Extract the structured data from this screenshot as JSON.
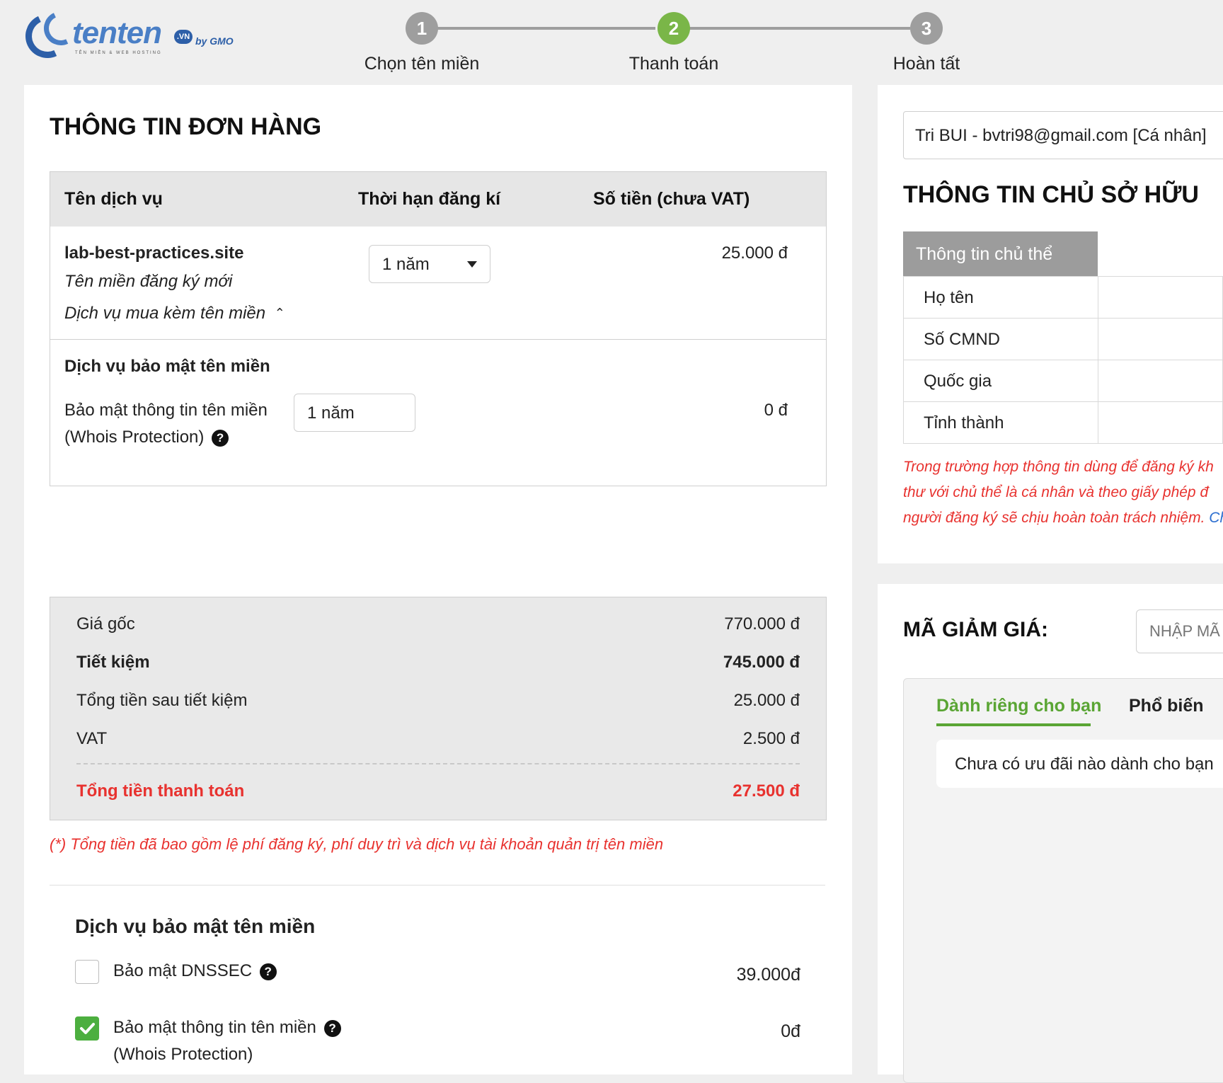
{
  "header": {
    "logo": {
      "brand": "tenten",
      "tld_badge": ".VN",
      "partner": "by GMO",
      "tagline": "TÊN MIỀN & WEB HOSTING"
    },
    "steps": [
      {
        "number": "1",
        "label": "Chọn tên miền",
        "state": "done"
      },
      {
        "number": "2",
        "label": "Thanh toán",
        "state": "active"
      },
      {
        "number": "3",
        "label": "Hoàn tất",
        "state": "pending"
      }
    ]
  },
  "order": {
    "title": "THÔNG TIN ĐƠN HÀNG",
    "columns": [
      "Tên dịch vụ",
      "Thời hạn đăng kí",
      "Số tiền (chưa VAT)"
    ],
    "domain_item": {
      "name": "lab-best-practices.site",
      "type": "Tên miền đăng ký mới",
      "addon_toggle": "Dịch vụ mua kèm tên miền",
      "term": "1 năm",
      "price": "25.000 đ"
    },
    "security_item": {
      "heading": "Dịch vụ bảo mật tên miền",
      "name_line1": "Bảo mật thông tin tên miền",
      "name_line2": "(Whois Protection)",
      "term": "1 năm",
      "price": "0 đ"
    },
    "summary": {
      "rows": [
        {
          "label": "Giá gốc",
          "value": "770.000 đ"
        },
        {
          "label": "Tiết kiệm",
          "value": "745.000 đ"
        },
        {
          "label": "Tổng tiền sau tiết kiệm",
          "value": "25.000 đ"
        },
        {
          "label": "VAT",
          "value": "2.500 đ"
        }
      ],
      "total_label": "Tổng tiền thanh toán",
      "total_value": "27.500 đ"
    },
    "note": "(*) Tổng tiền đã bao gồm lệ phí đăng ký, phí duy trì và dịch vụ tài khoản quản trị tên miền"
  },
  "security_services": {
    "heading": "Dịch vụ bảo mật tên miền",
    "options": [
      {
        "label": "Bảo mật DNSSEC",
        "label2": "",
        "price": "39.000đ",
        "checked": false
      },
      {
        "label": "Bảo mật thông tin tên miền",
        "label2": "(Whois Protection)",
        "price": "0đ",
        "checked": true
      }
    ]
  },
  "account": {
    "selected": "Tri BUI - bvtri98@gmail.com [Cá nhân]"
  },
  "owner": {
    "title": "THÔNG TIN CHỦ SỞ HỮU",
    "tab_label": "Thông tin chủ thể",
    "fields": [
      "Họ tên",
      "Số CMND",
      "Quốc gia",
      "Tỉnh thành"
    ],
    "warning_line1": "Trong trường hợp thông tin dùng để đăng ký kh",
    "warning_line2": "thư với chủ thể là cá nhân và theo giấy phép đ",
    "warning_line3": "người đăng ký sẽ chịu hoàn toàn trách nhiệm.",
    "warning_link": "Ch"
  },
  "discount": {
    "title": "MÃ GIẢM GIÁ:",
    "placeholder": "NHẬP MÃ",
    "tabs": [
      "Dành riêng cho bạn",
      "Phổ biến"
    ],
    "empty_message": "Chưa có ưu đãi nào dành cho bạn"
  },
  "colors": {
    "accent_green": "#7ab648",
    "tab_green": "#5aa534",
    "warning_red": "#e8322f",
    "brand_blue": "#2d5fa8",
    "step_gray": "#9e9e9e"
  }
}
